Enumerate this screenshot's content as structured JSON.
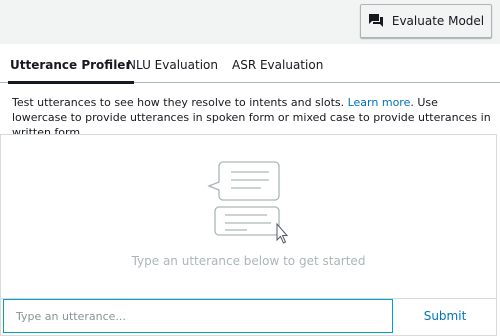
{
  "header": {
    "evaluate_button": {
      "label": "Evaluate Model",
      "icon": "chat-bubbles-icon"
    }
  },
  "tabs": [
    {
      "label": "Utterance Profiler",
      "active": true
    },
    {
      "label": "NLU Evaluation",
      "active": false
    },
    {
      "label": "ASR Evaluation",
      "active": false
    }
  ],
  "description": {
    "before_link": "Test utterances to see how they resolve to intents and slots. ",
    "link": "Learn more",
    "after_link": ". Use lowercase to provide utterances in spoken form or mixed case to provide utterances in written form."
  },
  "empty_state": {
    "icon": "conversation-illustration-icon",
    "hint": "Type an utterance below to get started"
  },
  "input": {
    "placeholder": "Type an utterance...",
    "value": "",
    "submit_label": "Submit"
  },
  "colors": {
    "link": "#0073bb",
    "input_focus_border": "#00a1c9",
    "hint_text": "#aab7b8",
    "toolbar_bg": "#f2f3f3"
  }
}
